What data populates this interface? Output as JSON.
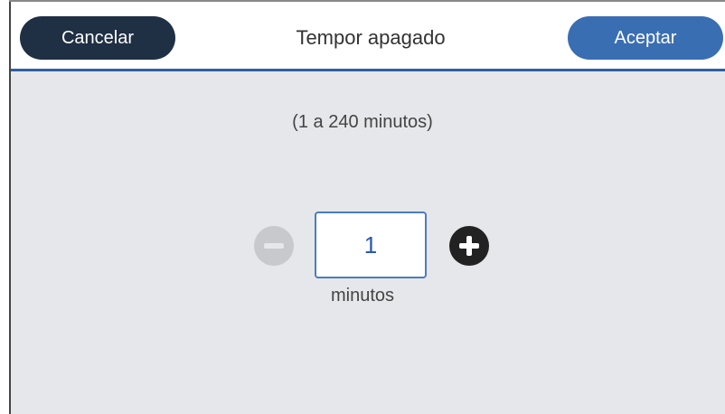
{
  "header": {
    "title": "Tempor apagado",
    "cancel_label": "Cancelar",
    "accept_label": "Aceptar"
  },
  "timer": {
    "range_text": "(1 a 240 minutos)",
    "value": "1",
    "unit": "minutos"
  },
  "icons": {
    "decrement": "minus-circle-icon",
    "increment": "plus-circle-icon"
  },
  "colors": {
    "cancel_button": "#1f2f44",
    "accept_button": "#3a6eb3",
    "header_divider": "#2f5fa3",
    "content_background": "#e6e7ea",
    "value_text": "#2a5aa8"
  }
}
